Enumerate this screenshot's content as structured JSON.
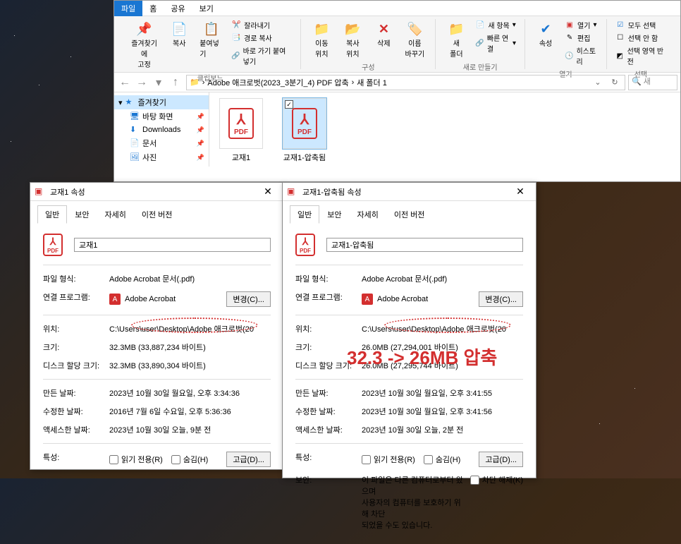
{
  "explorer": {
    "tabs": {
      "file": "파일",
      "home": "홈",
      "share": "공유",
      "view": "보기"
    },
    "ribbon": {
      "clipboard": {
        "pin": "즐겨찾기에\n고정",
        "copy": "복사",
        "paste": "붙여넣기",
        "cut": "잘라내기",
        "copypath": "경로 복사",
        "pasteshortcut": "바로 가기 붙여넣기",
        "label": "클립보드"
      },
      "organize": {
        "move": "이동\n위치",
        "copyto": "복사\n위치",
        "delete": "삭제",
        "rename": "이름\n바꾸기",
        "label": "구성"
      },
      "new": {
        "folder": "새\n폴더",
        "newitem": "새 항목",
        "easyaccess": "빠른 연결",
        "label": "새로 만들기"
      },
      "open": {
        "props": "속성",
        "open": "열기",
        "edit": "편집",
        "history": "히스토리",
        "label": "열기"
      },
      "select": {
        "all": "모두 선택",
        "none": "선택 안 함",
        "invert": "선택 영역 반전",
        "label": "선택"
      }
    },
    "path": {
      "seg1": "Adobe 애크로벗(2023_3분기_4) PDF 압축",
      "seg2": "새 폴더 1",
      "search_placeholder": "새"
    },
    "nav": {
      "quick": "즐겨찾기",
      "desktop": "바탕 화면",
      "downloads": "Downloads",
      "docs": "문서",
      "pics": "사진"
    },
    "files": {
      "file1": "교재1",
      "file2": "교재1-압축됨"
    }
  },
  "props1": {
    "title": "교재1 속성",
    "tabs": {
      "general": "일반",
      "security": "보안",
      "details": "자세히",
      "prev": "이전 버전"
    },
    "name": "교재1",
    "fields": {
      "filetype_label": "파일 형식:",
      "filetype": "Adobe Acrobat 문서(.pdf)",
      "opens_label": "연결 프로그램:",
      "opens": "Adobe Acrobat",
      "change": "변경(C)...",
      "loc_label": "위치:",
      "loc": "C:\\Users\\user\\Desktop\\Adobe 애크로벗(20",
      "size_label": "크기:",
      "size": "32.3MB (33,887,234 바이트)",
      "ondisk_label": "디스크 할당 크기:",
      "ondisk": "32.3MB (33,890,304 바이트)",
      "created_label": "만든 날짜:",
      "created": "2023년 10월 30일 월요일, 오후 3:34:36",
      "modified_label": "수정한 날짜:",
      "modified": "2016년 7월 6일 수요일, 오후 5:36:36",
      "accessed_label": "액세스한 날짜:",
      "accessed": "2023년 10월 30일 오늘, 9분 전",
      "attrs_label": "특성:",
      "readonly": "읽기 전용(R)",
      "hidden": "숨김(H)",
      "advanced": "고급(D)..."
    }
  },
  "props2": {
    "title": "교재1-압축됨 속성",
    "tabs": {
      "general": "일반",
      "security": "보안",
      "details": "자세히",
      "prev": "이전 버전"
    },
    "name": "교재1-압축됨",
    "fields": {
      "filetype_label": "파일 형식:",
      "filetype": "Adobe Acrobat 문서(.pdf)",
      "opens_label": "연결 프로그램:",
      "opens": "Adobe Acrobat",
      "change": "변경(C)...",
      "loc_label": "위치:",
      "loc": "C:\\Users\\user\\Desktop\\Adobe 애크로벗(20",
      "size_label": "크기:",
      "size": "26.0MB (27,294,001 바이트)",
      "ondisk_label": "디스크 할당 크기:",
      "ondisk": "26.0MB (27,295,744 바이트)",
      "created_label": "만든 날짜:",
      "created": "2023년 10월 30일 월요일, 오후 3:41:55",
      "modified_label": "수정한 날짜:",
      "modified": "2023년 10월 30일 월요일, 오후 3:41:56",
      "accessed_label": "액세스한 날짜:",
      "accessed": "2023년 10월 30일 오늘, 2분 전",
      "attrs_label": "특성:",
      "readonly": "읽기 전용(R)",
      "hidden": "숨김(H)",
      "advanced": "고급(D)...",
      "sec_label": "보안:",
      "sec_text": "이 파일은 다른 컴퓨터로부터 왔으며\n사용자의 컴퓨터를 보호하기 위해 차단\n되었을 수도 있습니다.",
      "unblock": "차단 해제(K)"
    }
  },
  "annotation": "32.3 -> 26MB 압축"
}
